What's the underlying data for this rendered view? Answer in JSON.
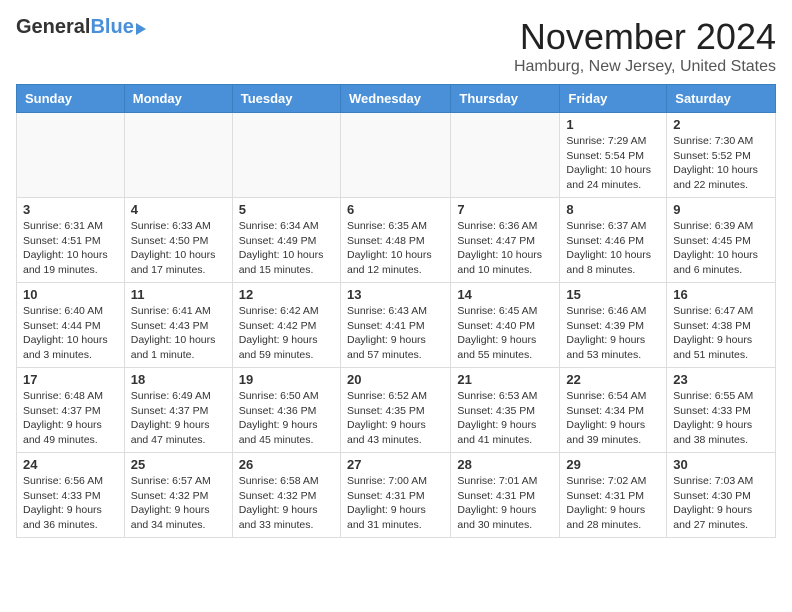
{
  "logo": {
    "general": "General",
    "blue": "Blue"
  },
  "title": "November 2024",
  "location": "Hamburg, New Jersey, United States",
  "days_of_week": [
    "Sunday",
    "Monday",
    "Tuesday",
    "Wednesday",
    "Thursday",
    "Friday",
    "Saturday"
  ],
  "weeks": [
    [
      {
        "day": "",
        "info": ""
      },
      {
        "day": "",
        "info": ""
      },
      {
        "day": "",
        "info": ""
      },
      {
        "day": "",
        "info": ""
      },
      {
        "day": "",
        "info": ""
      },
      {
        "day": "1",
        "info": "Sunrise: 7:29 AM\nSunset: 5:54 PM\nDaylight: 10 hours and 24 minutes."
      },
      {
        "day": "2",
        "info": "Sunrise: 7:30 AM\nSunset: 5:52 PM\nDaylight: 10 hours and 22 minutes."
      }
    ],
    [
      {
        "day": "3",
        "info": "Sunrise: 6:31 AM\nSunset: 4:51 PM\nDaylight: 10 hours and 19 minutes."
      },
      {
        "day": "4",
        "info": "Sunrise: 6:33 AM\nSunset: 4:50 PM\nDaylight: 10 hours and 17 minutes."
      },
      {
        "day": "5",
        "info": "Sunrise: 6:34 AM\nSunset: 4:49 PM\nDaylight: 10 hours and 15 minutes."
      },
      {
        "day": "6",
        "info": "Sunrise: 6:35 AM\nSunset: 4:48 PM\nDaylight: 10 hours and 12 minutes."
      },
      {
        "day": "7",
        "info": "Sunrise: 6:36 AM\nSunset: 4:47 PM\nDaylight: 10 hours and 10 minutes."
      },
      {
        "day": "8",
        "info": "Sunrise: 6:37 AM\nSunset: 4:46 PM\nDaylight: 10 hours and 8 minutes."
      },
      {
        "day": "9",
        "info": "Sunrise: 6:39 AM\nSunset: 4:45 PM\nDaylight: 10 hours and 6 minutes."
      }
    ],
    [
      {
        "day": "10",
        "info": "Sunrise: 6:40 AM\nSunset: 4:44 PM\nDaylight: 10 hours and 3 minutes."
      },
      {
        "day": "11",
        "info": "Sunrise: 6:41 AM\nSunset: 4:43 PM\nDaylight: 10 hours and 1 minute."
      },
      {
        "day": "12",
        "info": "Sunrise: 6:42 AM\nSunset: 4:42 PM\nDaylight: 9 hours and 59 minutes."
      },
      {
        "day": "13",
        "info": "Sunrise: 6:43 AM\nSunset: 4:41 PM\nDaylight: 9 hours and 57 minutes."
      },
      {
        "day": "14",
        "info": "Sunrise: 6:45 AM\nSunset: 4:40 PM\nDaylight: 9 hours and 55 minutes."
      },
      {
        "day": "15",
        "info": "Sunrise: 6:46 AM\nSunset: 4:39 PM\nDaylight: 9 hours and 53 minutes."
      },
      {
        "day": "16",
        "info": "Sunrise: 6:47 AM\nSunset: 4:38 PM\nDaylight: 9 hours and 51 minutes."
      }
    ],
    [
      {
        "day": "17",
        "info": "Sunrise: 6:48 AM\nSunset: 4:37 PM\nDaylight: 9 hours and 49 minutes."
      },
      {
        "day": "18",
        "info": "Sunrise: 6:49 AM\nSunset: 4:37 PM\nDaylight: 9 hours and 47 minutes."
      },
      {
        "day": "19",
        "info": "Sunrise: 6:50 AM\nSunset: 4:36 PM\nDaylight: 9 hours and 45 minutes."
      },
      {
        "day": "20",
        "info": "Sunrise: 6:52 AM\nSunset: 4:35 PM\nDaylight: 9 hours and 43 minutes."
      },
      {
        "day": "21",
        "info": "Sunrise: 6:53 AM\nSunset: 4:35 PM\nDaylight: 9 hours and 41 minutes."
      },
      {
        "day": "22",
        "info": "Sunrise: 6:54 AM\nSunset: 4:34 PM\nDaylight: 9 hours and 39 minutes."
      },
      {
        "day": "23",
        "info": "Sunrise: 6:55 AM\nSunset: 4:33 PM\nDaylight: 9 hours and 38 minutes."
      }
    ],
    [
      {
        "day": "24",
        "info": "Sunrise: 6:56 AM\nSunset: 4:33 PM\nDaylight: 9 hours and 36 minutes."
      },
      {
        "day": "25",
        "info": "Sunrise: 6:57 AM\nSunset: 4:32 PM\nDaylight: 9 hours and 34 minutes."
      },
      {
        "day": "26",
        "info": "Sunrise: 6:58 AM\nSunset: 4:32 PM\nDaylight: 9 hours and 33 minutes."
      },
      {
        "day": "27",
        "info": "Sunrise: 7:00 AM\nSunset: 4:31 PM\nDaylight: 9 hours and 31 minutes."
      },
      {
        "day": "28",
        "info": "Sunrise: 7:01 AM\nSunset: 4:31 PM\nDaylight: 9 hours and 30 minutes."
      },
      {
        "day": "29",
        "info": "Sunrise: 7:02 AM\nSunset: 4:31 PM\nDaylight: 9 hours and 28 minutes."
      },
      {
        "day": "30",
        "info": "Sunrise: 7:03 AM\nSunset: 4:30 PM\nDaylight: 9 hours and 27 minutes."
      }
    ]
  ]
}
